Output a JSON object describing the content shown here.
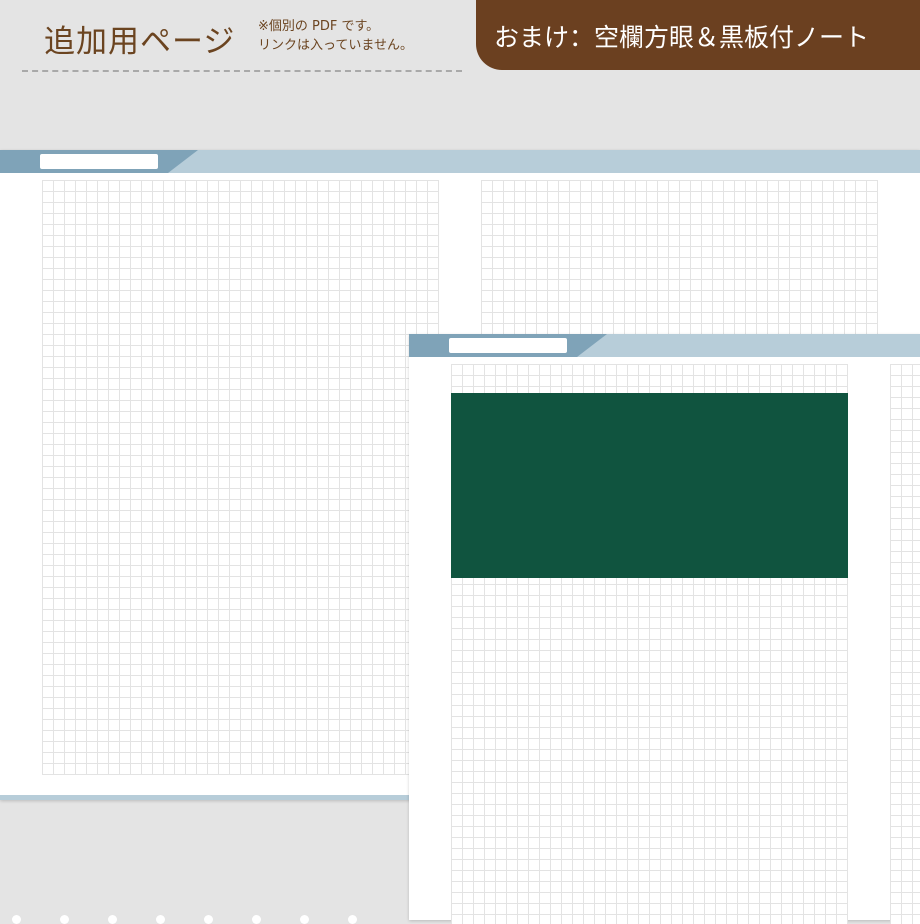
{
  "header": {
    "title": "追加用ページ",
    "note_line1": "※個別の PDF です。",
    "note_line2": "リンクは入っていません。"
  },
  "bonus_banner": {
    "text": "おまけ：空欄方眼＆黒板付ノート"
  },
  "colors": {
    "brand_brown": "#6b4020",
    "tab_blue_dark": "#7fa3b8",
    "tab_blue_light": "#b7cdd9",
    "chalkboard_green": "#10543f",
    "grid_line": "#e3e3e3",
    "background": "#e4e4e4"
  },
  "pages": [
    {
      "name": "blank-grid-note"
    },
    {
      "name": "chalkboard-grid-note"
    }
  ]
}
